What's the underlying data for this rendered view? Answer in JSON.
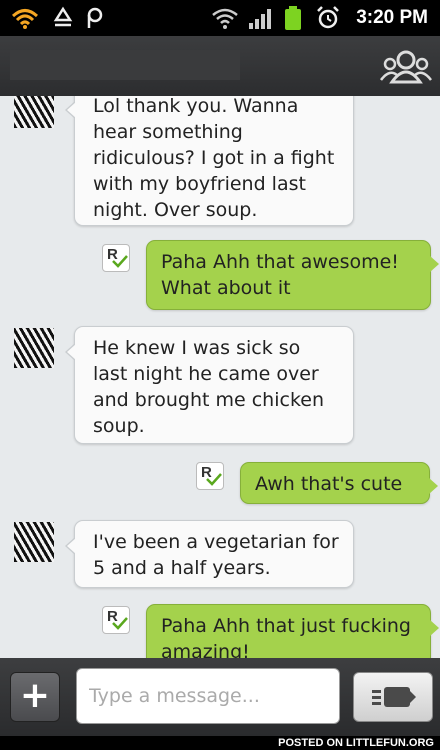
{
  "status_bar": {
    "time": "3:20 PM",
    "icons": [
      "wifi-icon",
      "recycle-icon",
      "p-icon",
      "wifi-signal-icon",
      "cell-signal-icon",
      "battery-icon",
      "alarm-icon"
    ]
  },
  "header": {
    "contact_name": "",
    "contacts_icon": "contacts-icon"
  },
  "messages": [
    {
      "direction": "in",
      "text": "Lol thank you. Wanna hear something ridiculous? I got in a fight with my boyfriend last night. Over soup."
    },
    {
      "direction": "out",
      "text": "Paha Ahh that awesome! What about it",
      "read_badge": "R"
    },
    {
      "direction": "in",
      "text": "He knew I was sick so last night he came over and brought me chicken soup."
    },
    {
      "direction": "out",
      "text": "Awh that's cute",
      "read_badge": "R"
    },
    {
      "direction": "in",
      "text": "I've been a vegetarian for 5 and a half years."
    },
    {
      "direction": "out",
      "text": "Paha Ahh that just fucking amazing!",
      "read_badge": "R"
    }
  ],
  "composer": {
    "placeholder": "Type a message...",
    "value": ""
  },
  "watermark": "POSTED ON LITTLEFUN.ORG",
  "colors": {
    "outgoing_bubble": "#a4d24c",
    "incoming_bubble": "#fafafa",
    "chat_background": "#e7eaec",
    "bar_background": "#2f3032"
  }
}
